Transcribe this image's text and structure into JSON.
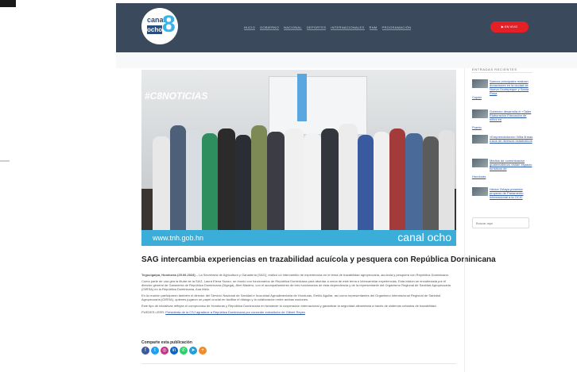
{
  "logo": {
    "word": "canal",
    "box": "ocho",
    "digit": "8"
  },
  "nav": [
    "INICIO",
    "GOBIERNO",
    "NACIONAL",
    "DEPORTES",
    "INTERNACIONALES",
    "RNM",
    "PROGRAMACIÓN"
  ],
  "live_button": "EN VIVO",
  "photo": {
    "hashtag": "#C8NOTICIAS",
    "url": "www.tnh.gob.hn",
    "brand": "canal ocho"
  },
  "article": {
    "title": "SAG intercambia experiencias en trazabilidad acuícola y pesquera con República Dominicana",
    "lead_bold": "Tegucigalpa, Honduras (25.06.2024)",
    "p1": "– La Secretaría de Agricultura y Ganadería (SAG), realizó un intercambio de experiencias en el tema de trazabilidad agropecuaria, acuícola y pesquera con República Dominicana.",
    "p2": "Como parte de una gira la titular de la SAG, Laura Elena Suazo, se reunió con funcionarios de República Dominicana para abordar a cerca de este tema e intercambiar experiencias. Esta misión se encabezada por el director general de Ganadería de República Dominicana (Digega), Abel Madero, con el acompañamiento de tres funcionarios de esta dependencia y de la representante del Organismo Regional de Sanidad Agropecuaria (OIRSA) en la República Dominicana, Ana Melo.",
    "p3": "En la reunión participaron también el director del Servicio Nacional de Sanidad e Inocuidad Agroalimentaria de Honduras, Emilio Aguilar, así como representantes del Organismo Internacional Regional de Sanidad Agropecuaria (OIRSA), quienes jugaron un papel crucial en facilitar el diálogo y la colaboración entre ambas naciones.",
    "p4": "Este tipo de iniciativas reflejan el compromiso de Honduras y República Dominicana en fortalecer la cooperación internacional y garantizar la seguridad alimentaria a través de sistemas robustos de trazabilidad.",
    "read_also_label": "PUEDES LEER:",
    "read_also_link": "Presidenta de la CSJ agradece a República Dominicana por conceder extradición de Gilbert Reyes",
    "share_label": "Comparte esta publicación"
  },
  "share_icons": [
    {
      "name": "facebook-share-icon",
      "glyph": "f",
      "color": "#3b5998"
    },
    {
      "name": "twitter-share-icon",
      "glyph": "t",
      "color": "#1da1f2"
    },
    {
      "name": "instagram-share-icon",
      "glyph": "◎",
      "color": "#c13584"
    },
    {
      "name": "linkedin-share-icon",
      "glyph": "in",
      "color": "#0a66c2"
    },
    {
      "name": "whatsapp-share-icon",
      "glyph": "✆",
      "color": "#25d366"
    },
    {
      "name": "telegram-share-icon",
      "glyph": "➤",
      "color": "#229ed9"
    },
    {
      "name": "more-share-icon",
      "glyph": "+",
      "color": "#f28c28"
    }
  ],
  "sidebar": {
    "title": "ENTRADAS RECIENTES",
    "posts": [
      {
        "line1": "Sancos principales realizan",
        "line2": "donaciones en la ciudad de",
        "line3": "Nueva Ocotepeque y Santa Rosa",
        "tail": "Copán"
      },
      {
        "line1": "Gobierno desarrolla el",
        "line2": "«Taller Elaboración",
        "line3": "Educación de niñez en",
        "tail": "Puerto"
      },
      {
        "line1": "«Emprendedores» Niña",
        "line2": "firmas rusos de diversos",
        "line3": "estadísticos",
        "tail": ""
      },
      {
        "line1": "Medios de comunicación",
        "line2": "guatemaltecos visitan",
        "line3": "espacio turísticos de",
        "tail": "Honduras"
      },
      {
        "line1": "Héctor Zelaya presenta",
        "line2": "proyecto de Parlamento",
        "line3": "Internacional a la OCIC",
        "tail": ""
      }
    ],
    "search_placeholder": "Buscar aquí"
  }
}
